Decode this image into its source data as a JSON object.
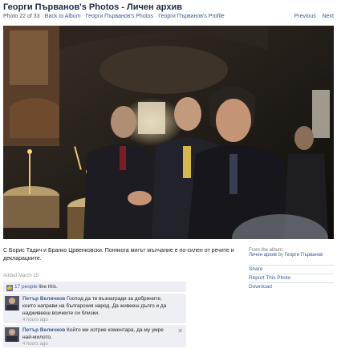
{
  "header": {
    "title": "Георги Първанов's Photos - Личен архив",
    "photo_counter": "Photo 22 of 33",
    "back_label": "Back to Album",
    "crumb_photos": "Георги Първанов's Photos",
    "crumb_profile": "Георги Първанов's Profile",
    "previous_label": "Previous",
    "next_label": "Next"
  },
  "photo": {
    "caption": "С Борис Тадич и Бранко Црвенковски. Понякога мигът мълчание е по-силен от речите и декларациите.",
    "added": "Added March 15"
  },
  "album": {
    "from_label": "From the album:",
    "album_name": "Личен архив",
    "by_label": "by",
    "owner": "Георги Първанов"
  },
  "actions": {
    "share": "Share",
    "report": "Report This Photo",
    "download": "Download"
  },
  "likes": {
    "count": "17 people",
    "suffix": " like this."
  },
  "comments": [
    {
      "author": "Петър Величков",
      "text": "Господ да те възнагради за добрините, които направи на българския народ. Да живееш дълго и да надживееш всичките си близки.",
      "time": "4 hours ago"
    },
    {
      "author": "Петър Величков",
      "text": "Който ми изтрие коментара, да му умре най-милото.",
      "time": "4 hours ago"
    }
  ],
  "colors": {
    "link": "#3b5998",
    "comment_bg": "#edeff4"
  }
}
